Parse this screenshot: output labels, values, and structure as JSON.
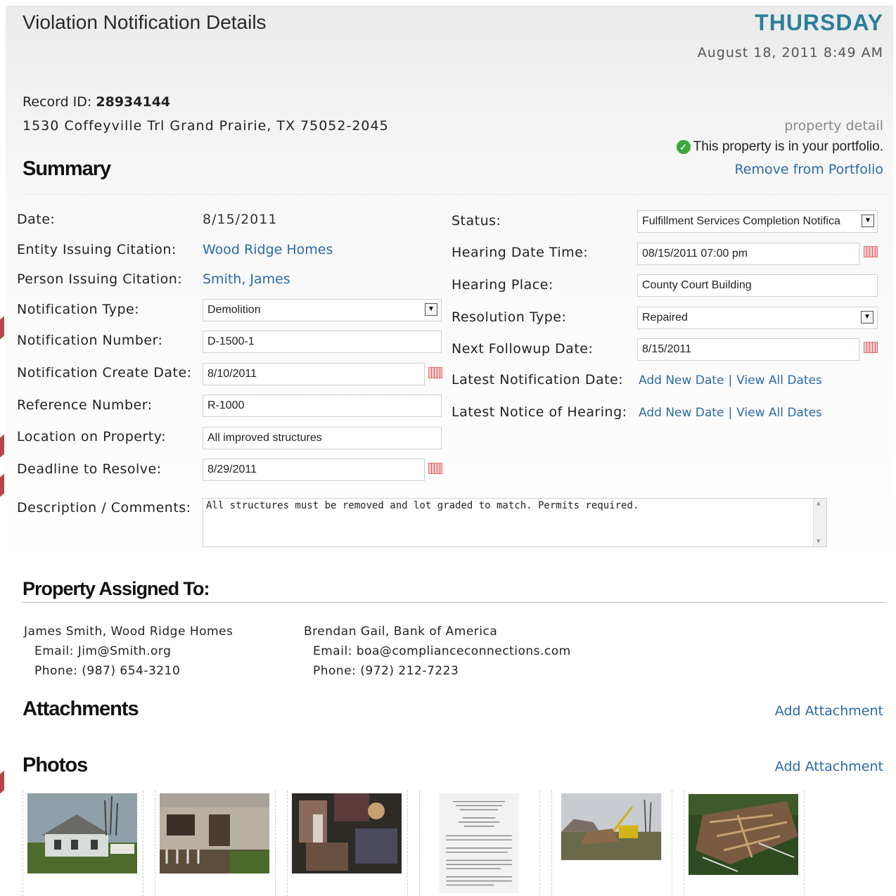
{
  "header": {
    "title": "Violation Notification Details",
    "day": "THURSDAY",
    "datetime": "August 18, 2011 8:49 AM"
  },
  "record": {
    "id_label": "Record ID:",
    "id_value": "28934144",
    "address": "1530 Coffeyville Trl Grand Prairie, TX 75052-2045"
  },
  "property_panel": {
    "detail_link": "property detail",
    "portfolio_status": "This property is in your portfolio.",
    "remove_link": "Remove from Portfolio"
  },
  "summary": {
    "heading": "Summary",
    "left": {
      "date_label": "Date:",
      "date_value": "8/15/2011",
      "entity_label": "Entity Issuing Citation:",
      "entity_value": "Wood Ridge Homes",
      "person_label": "Person Issuing Citation:",
      "person_value": "Smith, James",
      "notif_type_label": "Notification Type:",
      "notif_type_value": "Demolition",
      "notif_number_label": "Notification Number:",
      "notif_number_value": "D-1500-1",
      "notif_create_label": "Notification Create Date:",
      "notif_create_value": "8/10/2011",
      "reference_label": "Reference Number:",
      "reference_value": "R-1000",
      "location_label": "Location on Property:",
      "location_value": "All improved structures",
      "deadline_label": "Deadline to Resolve:",
      "deadline_value": "8/29/2011",
      "description_label": "Description / Comments:",
      "description_value": "All structures must be removed and lot graded to match. Permits required."
    },
    "right": {
      "status_label": "Status:",
      "status_value": "Fulfillment Services Completion Notifica",
      "hearing_dt_label": "Hearing Date Time:",
      "hearing_dt_value": "08/15/2011 07:00 pm",
      "hearing_place_label": "Hearing Place:",
      "hearing_place_value": "County Court Building",
      "resolution_label": "Resolution Type:",
      "resolution_value": "Repaired",
      "followup_label": "Next Followup Date:",
      "followup_value": "8/15/2011",
      "latest_notif_label": "Latest Notification Date:",
      "latest_hearing_label": "Latest Notice of Hearing:",
      "add_new_date": "Add New Date",
      "view_all_dates": "View All Dates",
      "separator": "|"
    }
  },
  "assigned": {
    "heading": "Property Assigned To:",
    "contacts": [
      {
        "name": "James Smith, Wood Ridge Homes",
        "email": "Email: Jim@Smith.org",
        "phone": "Phone: (987) 654-3210"
      },
      {
        "name": "Brendan Gail, Bank of America",
        "email": "Email: boa@complianceconnections.com",
        "phone": "Phone: (972) 212-7223"
      }
    ]
  },
  "attachments": {
    "heading": "Attachments",
    "add_label": "Add Attachment"
  },
  "photos": {
    "heading": "Photos",
    "add_label": "Add Attachment",
    "items": [
      "house-photo",
      "porch-photo",
      "interior-photo",
      "document-photo",
      "demolition-photo",
      "debris-photo"
    ]
  },
  "colors": {
    "accent": "#2b7f9a",
    "link": "#2a6aa8",
    "success": "#3aa83a"
  }
}
